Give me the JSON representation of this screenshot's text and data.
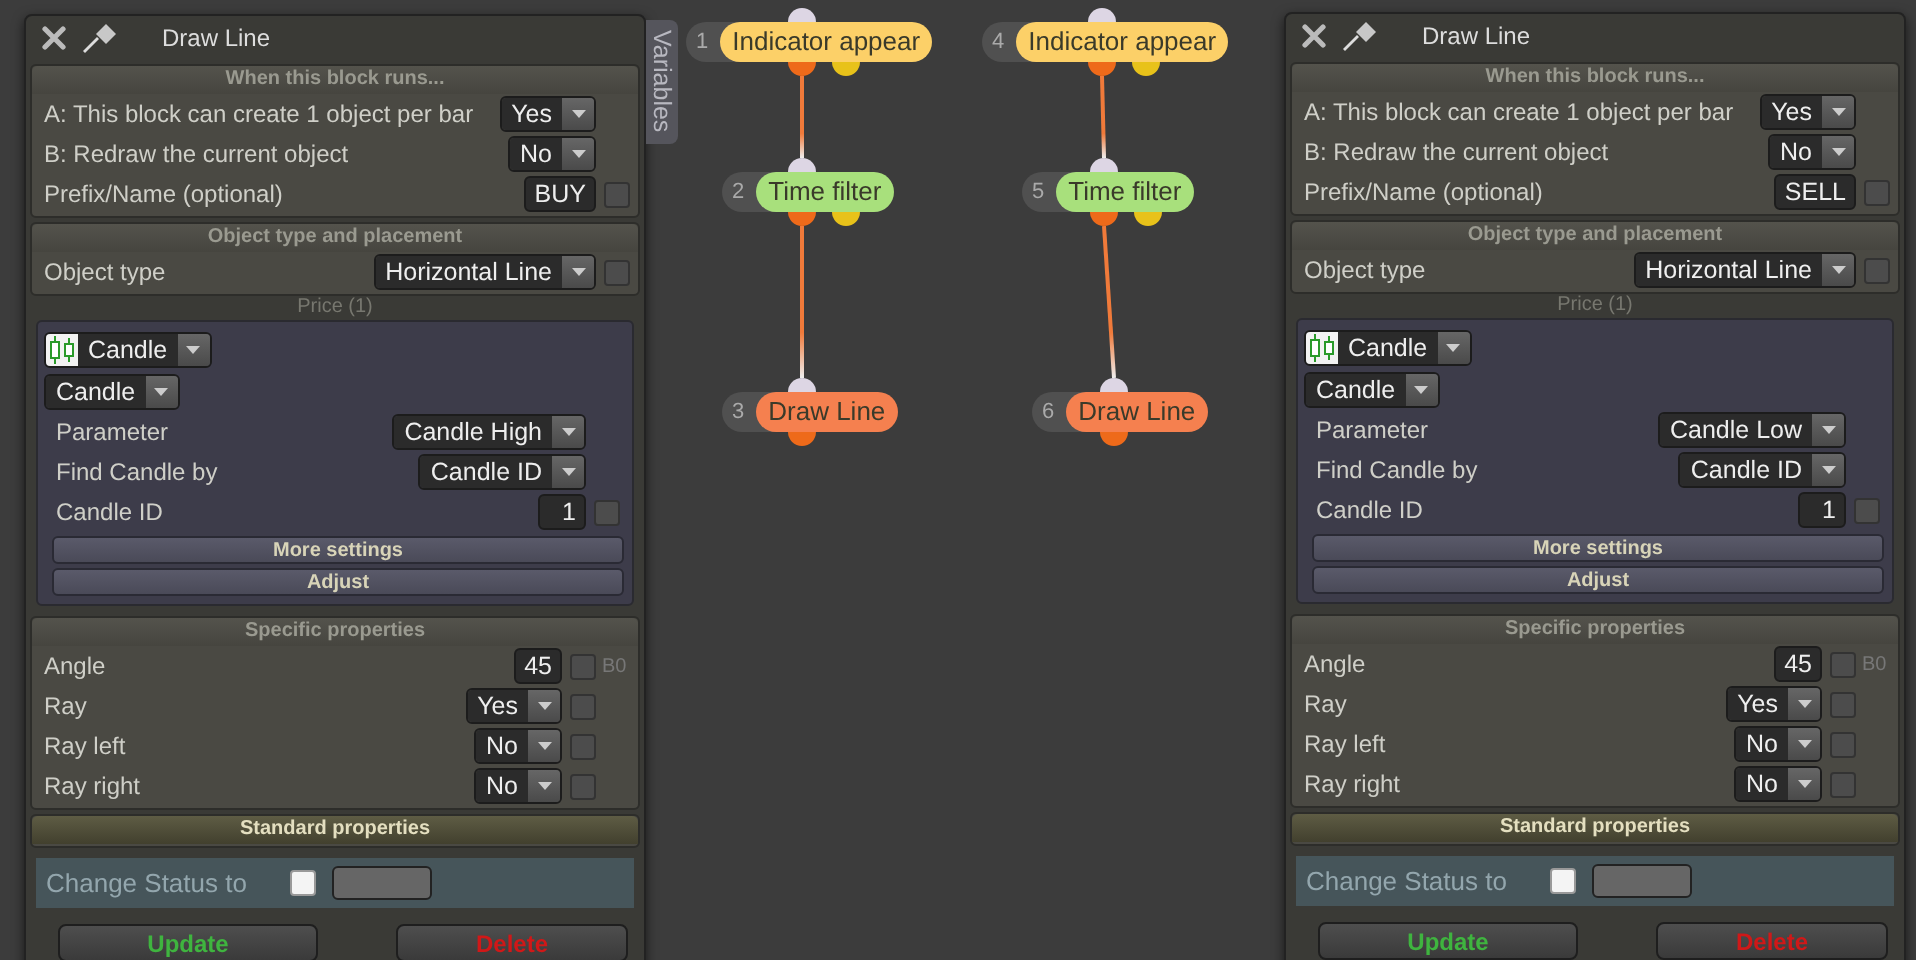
{
  "panels": [
    {
      "title": "Draw Line",
      "sections": [
        {
          "kind": "form",
          "header": "When this block runs...",
          "rows": [
            {
              "label": "A: This block can create 1 object per bar",
              "kind": "dropdown",
              "value": "Yes"
            },
            {
              "label": "B: Redraw the current object",
              "kind": "dropdown",
              "value": "No"
            },
            {
              "label": "Prefix/Name (optional)",
              "kind": "input",
              "value": "BUY",
              "checked": false
            }
          ]
        },
        {
          "kind": "form",
          "header": "Object type and placement",
          "rows": [
            {
              "label": "Object type",
              "kind": "dropdown",
              "value": "Horizontal Line",
              "checked": false
            }
          ]
        },
        {
          "kind": "price",
          "caption": "Price (1)",
          "source": "Candle",
          "subsource": "Candle",
          "rows": [
            {
              "label": "Parameter",
              "kind": "dropdown",
              "value": "Candle High"
            },
            {
              "label": "Find Candle by",
              "kind": "dropdown",
              "value": "Candle ID"
            },
            {
              "label": "Candle ID",
              "kind": "input",
              "value": "1",
              "checked": false
            }
          ],
          "buttons": [
            "More settings",
            "Adjust"
          ]
        },
        {
          "kind": "form",
          "header": "Specific properties",
          "rows": [
            {
              "label": "Angle",
              "kind": "input",
              "value": "45",
              "checked": false,
              "suffix": "B0"
            },
            {
              "label": "Ray",
              "kind": "dropdown",
              "value": "Yes",
              "checked": false
            },
            {
              "label": "Ray left",
              "kind": "dropdown",
              "value": "No",
              "checked": false
            },
            {
              "label": "Ray right",
              "kind": "dropdown",
              "value": "No",
              "checked": false
            }
          ]
        },
        {
          "kind": "status",
          "header": "Standard properties",
          "label": "Change Status to",
          "checked": false
        }
      ],
      "buttons": [
        {
          "label": "Update",
          "kind": "update"
        },
        {
          "label": "Delete",
          "kind": "delete"
        }
      ]
    },
    {
      "title": "Draw Line",
      "sections": [
        {
          "kind": "form",
          "header": "When this block runs...",
          "rows": [
            {
              "label": "A: This block can create 1 object per bar",
              "kind": "dropdown",
              "value": "Yes"
            },
            {
              "label": "B: Redraw the current object",
              "kind": "dropdown",
              "value": "No"
            },
            {
              "label": "Prefix/Name (optional)",
              "kind": "input",
              "value": "SELL",
              "checked": false
            }
          ]
        },
        {
          "kind": "form",
          "header": "Object type and placement",
          "rows": [
            {
              "label": "Object type",
              "kind": "dropdown",
              "value": "Horizontal Line",
              "checked": false
            }
          ]
        },
        {
          "kind": "price",
          "caption": "Price (1)",
          "source": "Candle",
          "subsource": "Candle",
          "rows": [
            {
              "label": "Parameter",
              "kind": "dropdown",
              "value": "Candle Low"
            },
            {
              "label": "Find Candle by",
              "kind": "dropdown",
              "value": "Candle ID"
            },
            {
              "label": "Candle ID",
              "kind": "input",
              "value": "1",
              "checked": false
            }
          ],
          "buttons": [
            "More settings",
            "Adjust"
          ]
        },
        {
          "kind": "form",
          "header": "Specific properties",
          "rows": [
            {
              "label": "Angle",
              "kind": "input",
              "value": "45",
              "checked": false,
              "suffix": "B0"
            },
            {
              "label": "Ray",
              "kind": "dropdown",
              "value": "Yes",
              "checked": false
            },
            {
              "label": "Ray left",
              "kind": "dropdown",
              "value": "No",
              "checked": false
            },
            {
              "label": "Ray right",
              "kind": "dropdown",
              "value": "No",
              "checked": false
            }
          ]
        },
        {
          "kind": "status",
          "header": "Standard properties",
          "label": "Change Status to",
          "checked": false
        }
      ],
      "buttons": [
        {
          "label": "Update",
          "kind": "update"
        },
        {
          "label": "Delete",
          "kind": "delete"
        }
      ]
    }
  ],
  "canvas": {
    "variables_tab": "Variables",
    "nodes": [
      {
        "number": "1",
        "label": "Indicator appear",
        "color": "#fcd068",
        "kind": "condition",
        "linked_to_next": true
      },
      {
        "number": "2",
        "label": "Time filter",
        "color": "#a8e07c",
        "kind": "condition",
        "linked_to_next": true
      },
      {
        "number": "3",
        "label": "Draw Line",
        "color": "#f5804f",
        "kind": "action"
      },
      {
        "number": "4",
        "label": "Indicator appear",
        "color": "#fcd068",
        "kind": "condition",
        "linked_to_next": true
      },
      {
        "number": "5",
        "label": "Time filter",
        "color": "#a8e07c",
        "kind": "condition",
        "linked_to_next": true
      },
      {
        "number": "6",
        "label": "Draw Line",
        "color": "#f5804f",
        "kind": "action"
      }
    ]
  }
}
